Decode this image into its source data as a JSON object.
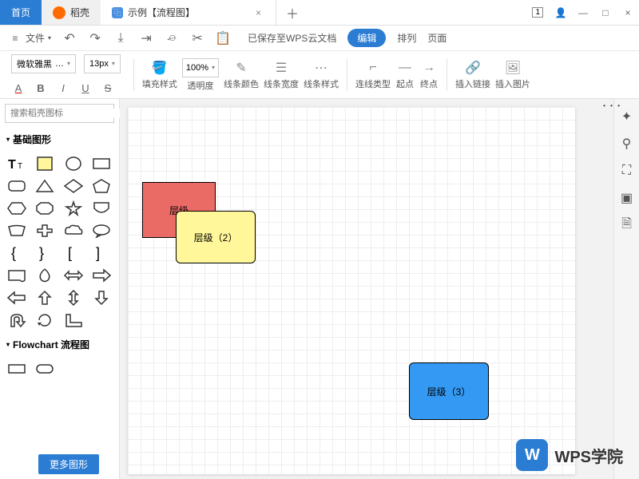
{
  "tabs": {
    "home": "首页",
    "daoker": "稻壳",
    "document": "示例【流程图】",
    "badge": "1"
  },
  "menu": {
    "file": "文件",
    "save_status": "已保存至WPS云文档",
    "edit_pill": "编辑",
    "arrange": "排列",
    "page": "页面"
  },
  "ribbon": {
    "font_name": "微软雅黑",
    "font_size": "13px",
    "zoom": "100%",
    "fill_style": "填充样式",
    "opacity": "透明度",
    "line_color": "线条颜色",
    "line_width": "线条宽度",
    "line_style": "线条样式",
    "conn_type": "连线类型",
    "start": "起点",
    "end": "终点",
    "insert_link": "插入链接",
    "insert_image": "插入图片"
  },
  "sidebar": {
    "search_placeholder": "搜索稻壳图标",
    "basic_shapes": "基础图形",
    "flowchart": "Flowchart 流程图",
    "more_shapes": "更多图形"
  },
  "canvas": {
    "shape1": "层级",
    "shape2": "层级（2）",
    "shape3": "层级（3）"
  },
  "watermark": "WPS学院"
}
